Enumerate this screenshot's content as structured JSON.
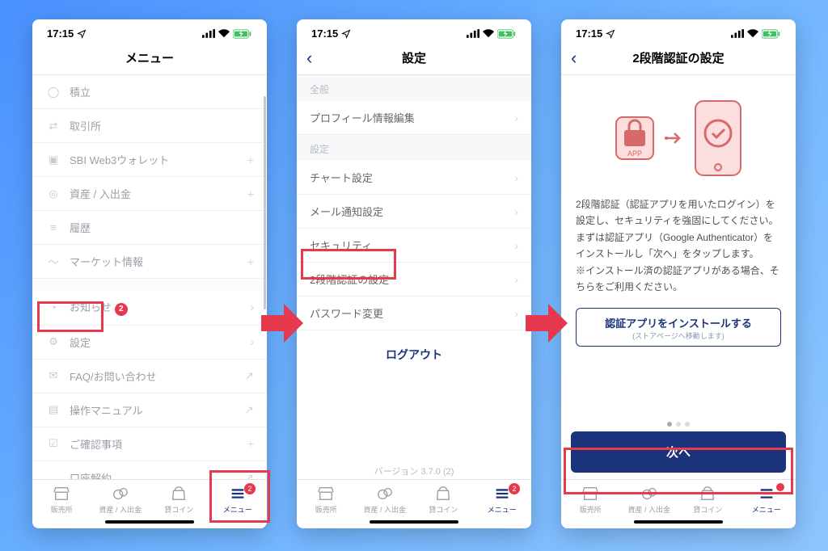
{
  "status": {
    "time": "17:15"
  },
  "screen1": {
    "title": "メニュー",
    "items": [
      {
        "label": "積立",
        "trail": ""
      },
      {
        "label": "取引所",
        "trail": ""
      },
      {
        "label": "SBI Web3ウォレット",
        "trail": "+"
      },
      {
        "label": "資産 / 入出金",
        "trail": "+"
      },
      {
        "label": "履歴",
        "trail": ""
      },
      {
        "label": "マーケット情報",
        "trail": "+"
      }
    ],
    "items2": [
      {
        "label": "お知らせ",
        "badge": "2",
        "trail": "›"
      },
      {
        "label": "設定",
        "trail": "›"
      },
      {
        "label": "FAQ/お問い合わせ",
        "trail": "↗"
      },
      {
        "label": "操作マニュアル",
        "trail": "↗"
      },
      {
        "label": "ご確認事項",
        "trail": "+"
      },
      {
        "label": "口座解約",
        "trail": "↗"
      }
    ]
  },
  "screen2": {
    "title": "設定",
    "section1": "全般",
    "items1": [
      {
        "label": "プロフィール情報編集",
        "trail": "›"
      }
    ],
    "section2": "設定",
    "items2": [
      {
        "label": "チャート設定",
        "trail": "›"
      },
      {
        "label": "メール通知設定",
        "trail": "›"
      },
      {
        "label": "セキュリティ",
        "trail": "›"
      },
      {
        "label": "2段階認証の設定",
        "trail": "›"
      },
      {
        "label": "パスワード変更",
        "trail": "›"
      }
    ],
    "logout": "ログアウト",
    "version": "バージョン 3.7.0 (2)"
  },
  "screen3": {
    "title": "2段階認証の設定",
    "desc_lines": [
      "2段階認証（認証アプリを用いたログイン）を設定し、セキュリティを強固にしてください。",
      "まずは認証アプリ（Google Authenticator）をインストールし「次へ」をタップします。",
      "※インストール済の認証アプリがある場合、そちらをご利用ください。"
    ],
    "install_main": "認証アプリをインストールする",
    "install_sub": "(ストアページへ移動します)",
    "primary": "次へ",
    "app_label": "APP"
  },
  "tabs": [
    {
      "label": "販売所"
    },
    {
      "label": "資産 / 入出金"
    },
    {
      "label": "貸コイン"
    },
    {
      "label": "メニュー",
      "badge": "2",
      "active": true
    }
  ]
}
